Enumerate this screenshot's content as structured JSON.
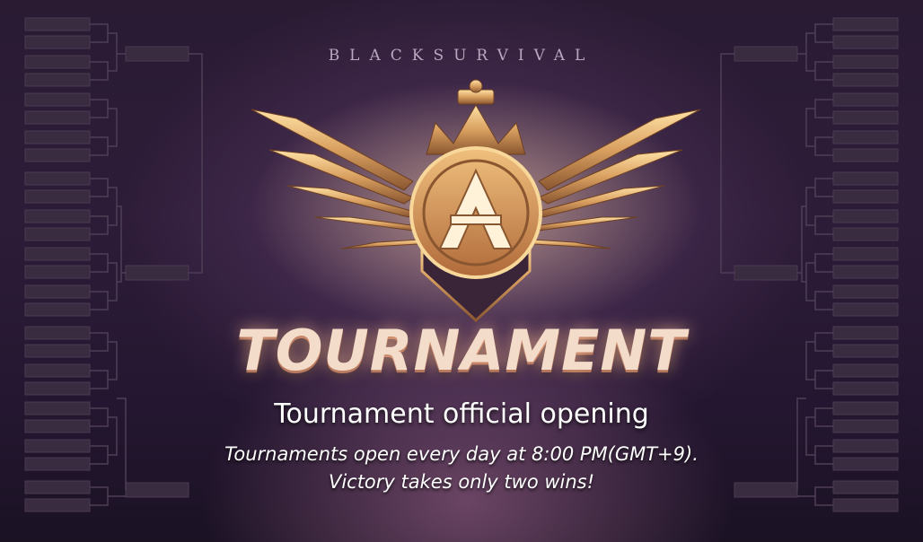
{
  "brand": "BLACKSURVIVAL",
  "title": "TOURNAMENT",
  "headline": "Tournament official opening",
  "description_lines": [
    "Tournaments open every day at 8:00 PM(GMT+9).",
    "Victory takes only two wins!"
  ],
  "colors": {
    "background": "#2a1b33",
    "gold": "#d9a060",
    "title_text": "#f4dccb",
    "body_text": "#ffffff"
  },
  "icons": [
    "tournament-emblem-icon",
    "crown-icon",
    "wing-icon"
  ]
}
